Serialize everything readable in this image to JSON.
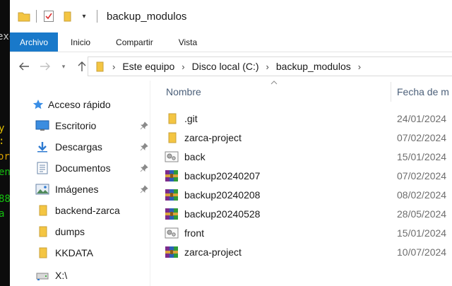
{
  "window": {
    "title": "backup_modulos"
  },
  "ribbon": {
    "tabs": [
      {
        "label": "Archivo"
      },
      {
        "label": "Inicio"
      },
      {
        "label": "Compartir"
      },
      {
        "label": "Vista"
      }
    ]
  },
  "address": {
    "crumbs": [
      "Este equipo",
      "Disco local (C:)",
      "backup_modulos"
    ]
  },
  "navigation": {
    "quick_access": "Acceso rápido",
    "items": [
      {
        "label": "Escritorio",
        "icon": "desktop-icon",
        "pinned": true
      },
      {
        "label": "Descargas",
        "icon": "download-icon",
        "pinned": true
      },
      {
        "label": "Documentos",
        "icon": "document-icon",
        "pinned": true
      },
      {
        "label": "Imágenes",
        "icon": "pictures-icon",
        "pinned": true
      },
      {
        "label": "backend-zarca",
        "icon": "folder-icon",
        "pinned": false
      },
      {
        "label": "dumps",
        "icon": "folder-icon",
        "pinned": false
      },
      {
        "label": "KKDATA",
        "icon": "folder-icon",
        "pinned": false
      },
      {
        "label": "X:\\",
        "icon": "network-drive-icon",
        "pinned": false
      }
    ]
  },
  "filelist": {
    "columns": {
      "name": "Nombre",
      "date": "Fecha de m"
    },
    "rows": [
      {
        "name": ".git",
        "date": "24/01/2024",
        "icon": "folder-icon"
      },
      {
        "name": "zarca-project",
        "date": "07/02/2024",
        "icon": "folder-icon"
      },
      {
        "name": "back",
        "date": "15/01/2024",
        "icon": "generic-file-icon"
      },
      {
        "name": "backup20240207",
        "date": "07/02/2024",
        "icon": "rar-archive-icon"
      },
      {
        "name": "backup20240208",
        "date": "08/02/2024",
        "icon": "rar-archive-icon"
      },
      {
        "name": "backup20240528",
        "date": "28/05/2024",
        "icon": "rar-archive-icon"
      },
      {
        "name": "front",
        "date": "15/01/2024",
        "icon": "generic-file-icon"
      },
      {
        "name": "zarca-project",
        "date": "10/07/2024",
        "icon": "rar-archive-icon"
      }
    ]
  },
  "terminal": {
    "lines": [
      "exe",
      "y",
      ":",
      "or",
      "en",
      "88",
      "a"
    ]
  },
  "colors": {
    "file_tab": "#1979ca",
    "folder": "#f4c542",
    "header_text": "#4c607a",
    "terminal_bg": "#0c0c0c"
  }
}
